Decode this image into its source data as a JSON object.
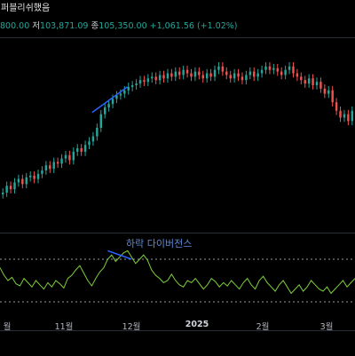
{
  "header": {
    "title": "퍼블리쉬했음",
    "ohlc": {
      "partial_open": "800.00",
      "low_label": "저",
      "low": "103,871.09",
      "close_label": "종",
      "close": "105,350.00",
      "change": "+1,061.56 (+1.02%)"
    }
  },
  "annotation": {
    "text": "하락 다이버전스"
  },
  "time_axis": {
    "labels": [
      {
        "text": "월",
        "bold": false
      },
      {
        "text": "11월",
        "bold": false
      },
      {
        "text": "12월",
        "bold": false
      },
      {
        "text": "2025",
        "bold": true
      },
      {
        "text": "2월",
        "bold": false
      },
      {
        "text": "3월",
        "bold": false
      }
    ]
  },
  "colors": {
    "up": "#26a69a",
    "down": "#ef5350",
    "trendline": "#2962ff",
    "rsi_line": "#7fcf3a",
    "band": "#9598a1",
    "annotation": "#5b8bd9"
  },
  "chart_data": [
    {
      "type": "candlestick",
      "title": "",
      "xlabel": "",
      "ylabel": "",
      "close_trajectory": [
        0.88,
        0.84,
        0.86,
        0.82,
        0.8,
        0.83,
        0.79,
        0.78,
        0.8,
        0.77,
        0.75,
        0.72,
        0.74,
        0.7,
        0.71,
        0.68,
        0.66,
        0.69,
        0.64,
        0.62,
        0.64,
        0.6,
        0.58,
        0.55,
        0.5,
        0.42,
        0.38,
        0.36,
        0.33,
        0.31,
        0.3,
        0.28,
        0.26,
        0.25,
        0.24,
        0.22,
        0.23,
        0.21,
        0.2,
        0.22,
        0.19,
        0.21,
        0.18,
        0.2,
        0.17,
        0.19,
        0.16,
        0.18,
        0.2,
        0.17,
        0.19,
        0.21,
        0.18,
        0.2,
        0.16,
        0.14,
        0.17,
        0.19,
        0.21,
        0.18,
        0.2,
        0.22,
        0.19,
        0.17,
        0.2,
        0.18,
        0.16,
        0.14,
        0.16,
        0.15,
        0.17,
        0.19,
        0.16,
        0.14,
        0.18,
        0.2,
        0.22,
        0.24,
        0.21,
        0.25,
        0.23,
        0.27,
        0.3,
        0.28,
        0.35,
        0.4,
        0.44,
        0.42,
        0.46,
        0.4
      ],
      "trendlines": [
        {
          "name": "price-divergence",
          "from": [
            23,
            0.41
          ],
          "to": [
            32,
            0.26
          ]
        }
      ]
    },
    {
      "type": "line",
      "title": "",
      "rsi_values": [
        62,
        55,
        50,
        53,
        47,
        45,
        52,
        48,
        44,
        50,
        46,
        42,
        48,
        44,
        50,
        47,
        43,
        52,
        55,
        60,
        64,
        57,
        50,
        45,
        52,
        58,
        62,
        70,
        74,
        68,
        72,
        76,
        78,
        72,
        66,
        70,
        74,
        69,
        60,
        55,
        52,
        48,
        50,
        56,
        50,
        46,
        44,
        50,
        48,
        52,
        47,
        42,
        46,
        52,
        49,
        44,
        48,
        45,
        50,
        46,
        42,
        48,
        52,
        46,
        42,
        50,
        54,
        48,
        44,
        40,
        46,
        50,
        44,
        38,
        42,
        46,
        40,
        44,
        50,
        46,
        42,
        40,
        44,
        38,
        42,
        46,
        50,
        44,
        48,
        52
      ],
      "band_upper": 70,
      "band_lower": 30,
      "trendlines": [
        {
          "name": "rsi-divergence",
          "from": [
            27,
            78
          ],
          "to": [
            33,
            70
          ]
        }
      ]
    }
  ]
}
